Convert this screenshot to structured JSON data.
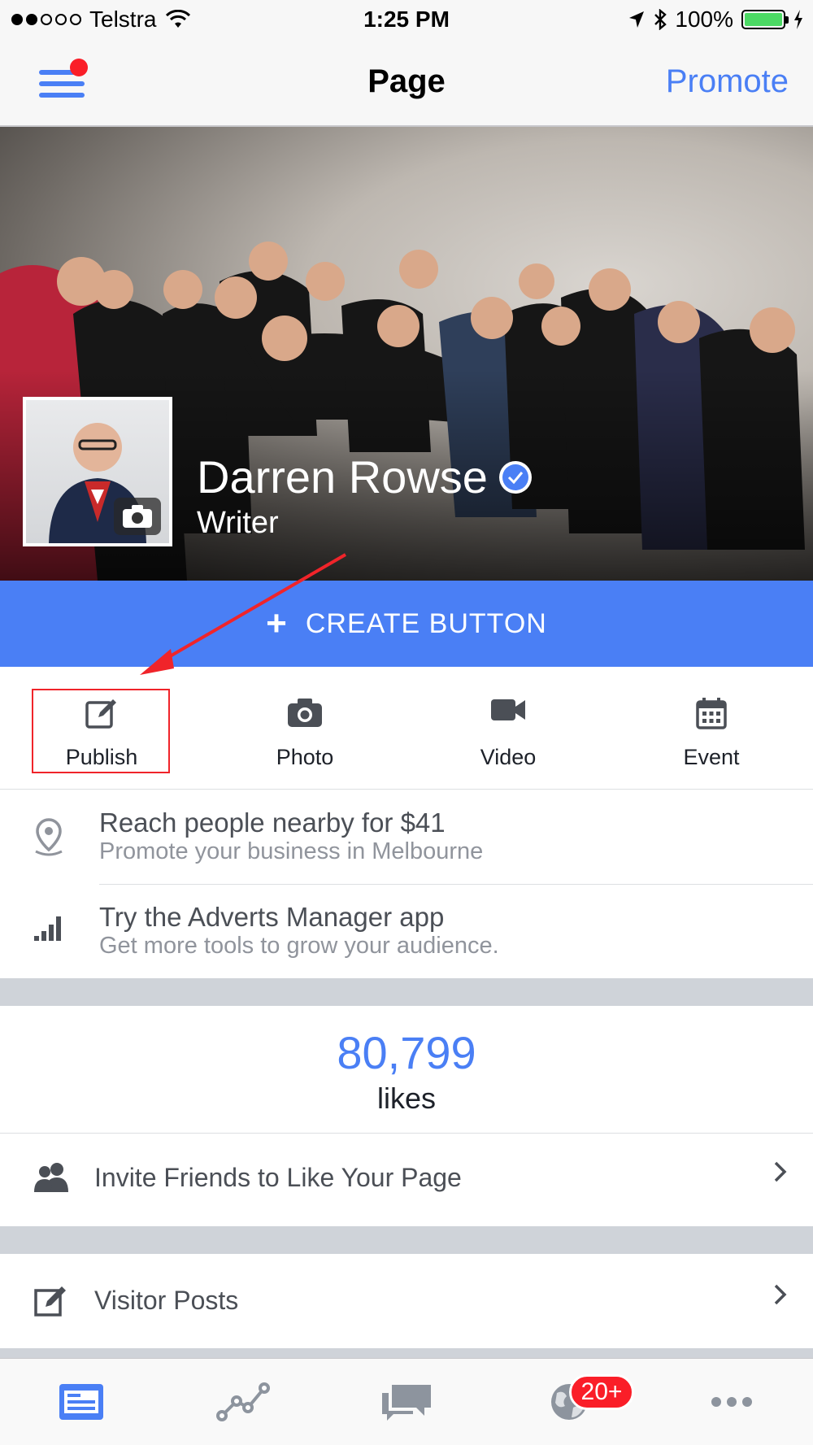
{
  "status_bar": {
    "carrier": "Telstra",
    "time": "1:25 PM",
    "battery": "100%"
  },
  "nav": {
    "title": "Page",
    "promote": "Promote"
  },
  "page": {
    "name": "Darren Rowse",
    "category": "Writer"
  },
  "create_button": "CREATE BUTTON",
  "actions": [
    {
      "label": "Publish",
      "icon": "edit-icon"
    },
    {
      "label": "Photo",
      "icon": "camera-icon"
    },
    {
      "label": "Video",
      "icon": "video-icon"
    },
    {
      "label": "Event",
      "icon": "calendar-icon"
    }
  ],
  "promos": [
    {
      "title": "Reach people nearby for $41",
      "subtitle": "Promote your business in Melbourne",
      "icon": "location-pin-icon"
    },
    {
      "title": "Try the Adverts Manager app",
      "subtitle": "Get more tools to grow your audience.",
      "icon": "bar-chart-icon"
    }
  ],
  "likes": {
    "count": "80,799",
    "label": "likes"
  },
  "rows": [
    {
      "label": "Invite Friends to Like Your Page",
      "icon": "friends-icon"
    },
    {
      "label": "Visitor Posts",
      "icon": "edit-box-icon"
    }
  ],
  "tabbar": {
    "tabs": [
      "page-tab-icon",
      "insights-icon",
      "messages-icon",
      "notifications-globe-icon",
      "more-icon"
    ],
    "notifications_badge": "20+"
  },
  "colors": {
    "accent": "#4a7ff5",
    "badge": "#fa1e28",
    "annotation": "#f0242a"
  }
}
